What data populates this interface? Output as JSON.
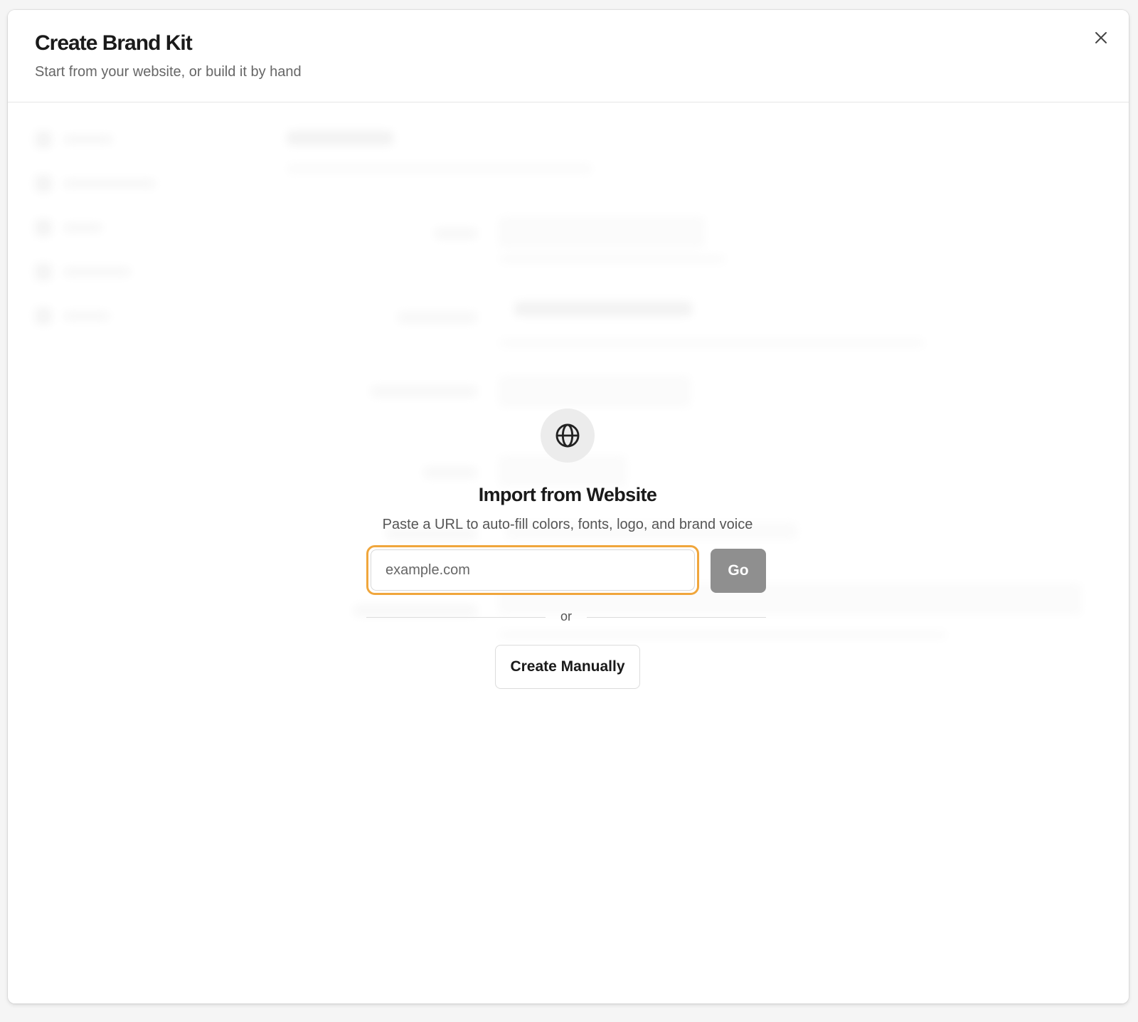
{
  "modal": {
    "title": "Create Brand Kit",
    "subtitle": "Start from your website, or build it by hand",
    "close_icon": "close-icon"
  },
  "import": {
    "icon": "globe-icon",
    "title": "Import from Website",
    "description": "Paste a URL to auto-fill colors, fonts, logo, and brand voice",
    "url_placeholder": "example.com",
    "url_value": "",
    "go_label": "Go",
    "divider_text": "or",
    "manual_label": "Create Manually"
  },
  "colors": {
    "focus_ring": "#f0a63c",
    "go_button": "#8f8f8f",
    "icon_circle": "#ececec"
  }
}
